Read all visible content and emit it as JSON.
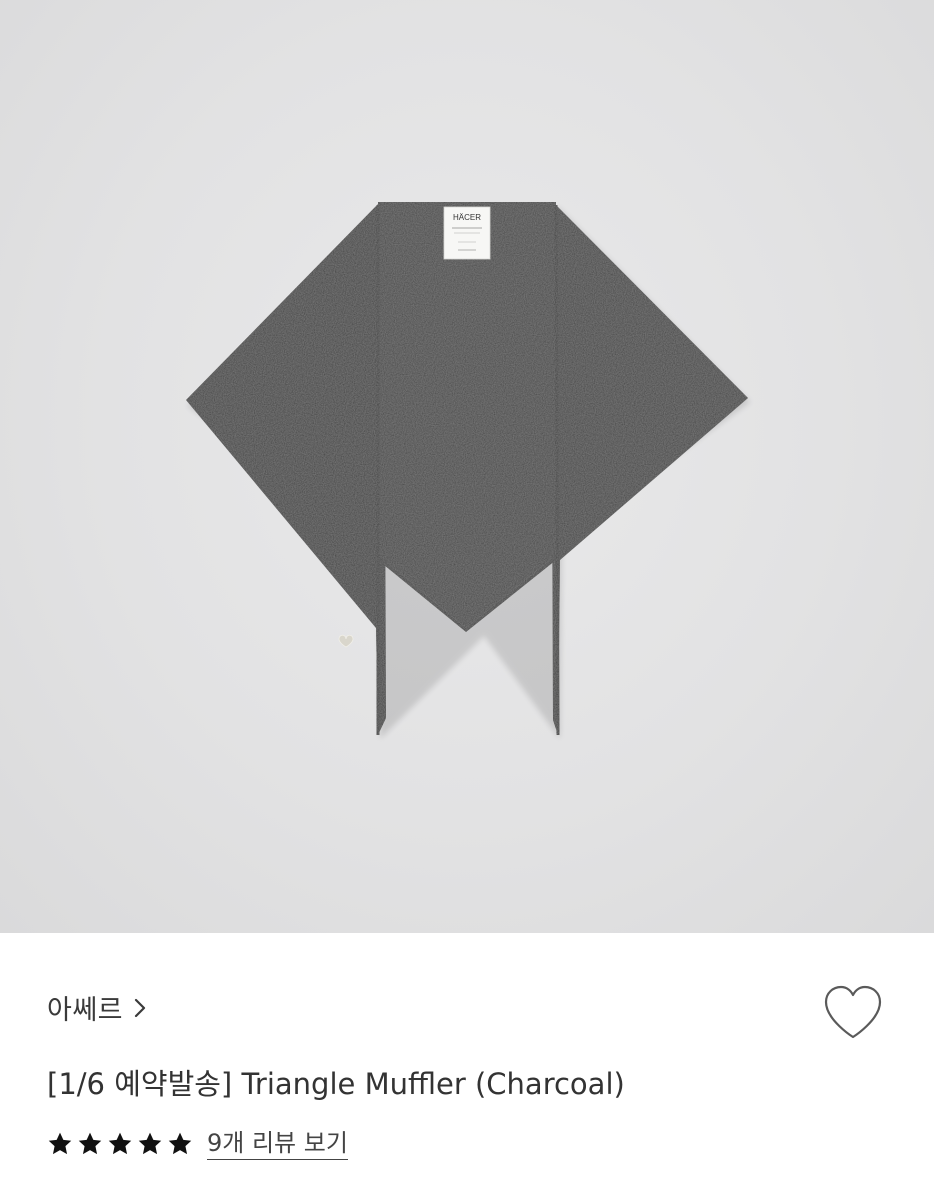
{
  "product": {
    "image_subject": "charcoal-triangle-knit-muffler",
    "tag_text": "HÄCER",
    "brand": "아쎄르",
    "title": "[1/6 예약발송] Triangle Muffler (Charcoal)",
    "rating": 5,
    "rating_max": 5,
    "review_link": "9개 리뷰 보기",
    "wishlisted": false
  },
  "colors": {
    "background": "#e4e4e5",
    "muffler": "#414141",
    "text": "#333333",
    "star": "#111111"
  },
  "icons": {
    "brand_chevron": "chevron-right-icon",
    "wishlist": "heart-outline-icon",
    "star": "star-filled-icon"
  }
}
